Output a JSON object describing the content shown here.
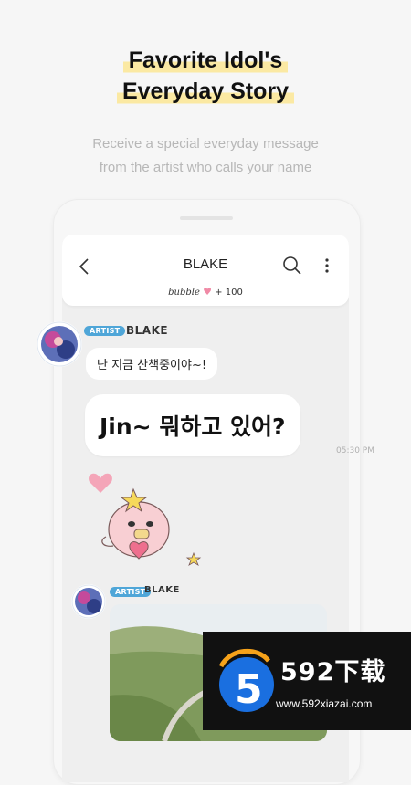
{
  "promo": {
    "headline_line1": "Favorite Idol's",
    "headline_line2": "Everyday Story",
    "subtitle_line1": "Receive a special everyday message",
    "subtitle_line2": "from the artist who calls your name"
  },
  "chat": {
    "title": "BLAKE",
    "bubble_label": "bubble",
    "bubble_count": "+ 100",
    "messages": [
      {
        "badge": "ARTIST",
        "sender": "BLAKE",
        "text": "난 지금 산책중이야~!"
      },
      {
        "text": "Jin~ 뭐하고 있어?",
        "time": "05:30 PM"
      },
      {
        "badge": "ARTIST",
        "sender": "BLAKE",
        "attachment": "photo"
      }
    ]
  },
  "watermark": {
    "brand": "592下载",
    "url": "www.592xiazai.com"
  },
  "colors": {
    "highlight": "#fbe9a3",
    "artist_badge": "#4fa6d8",
    "heart": "#f08aa6"
  },
  "icons": [
    "back-icon",
    "search-icon",
    "more-icon",
    "heart-icon",
    "sticker",
    "watermark-logo"
  ]
}
